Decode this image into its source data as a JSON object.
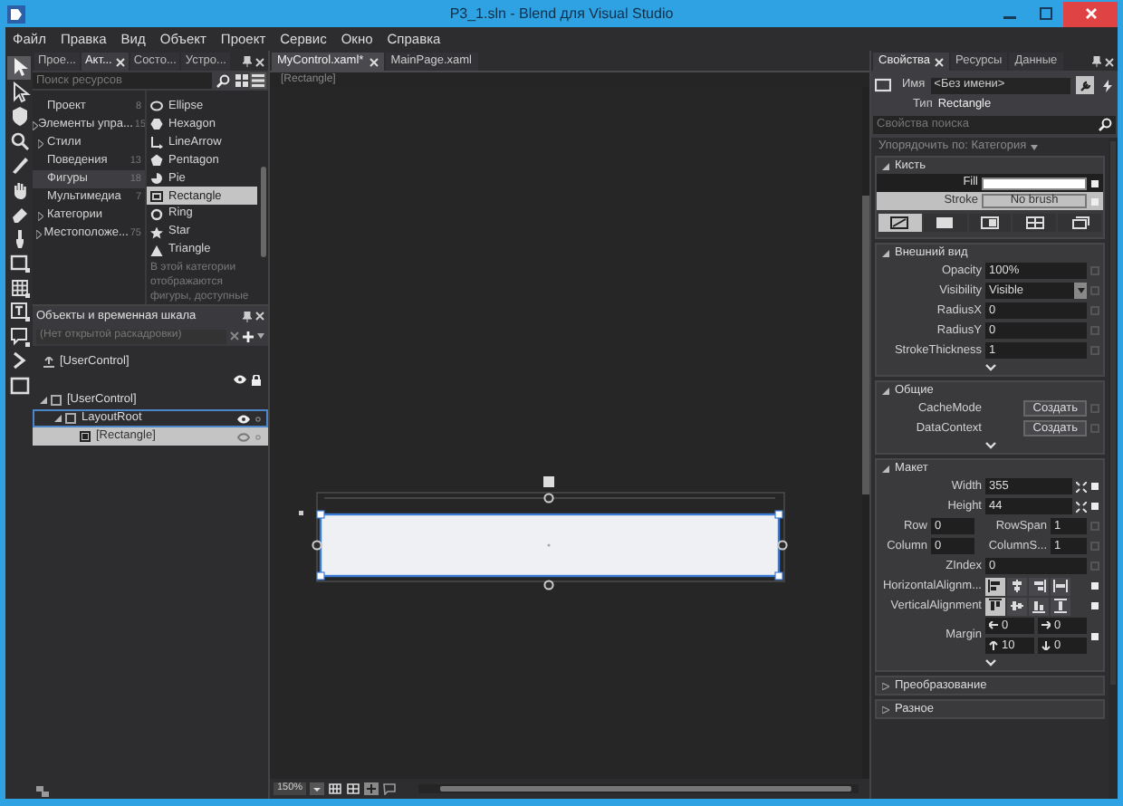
{
  "window": {
    "title": "P3_1.sln - Blend для Visual Studio"
  },
  "menu": [
    "Файл",
    "Правка",
    "Вид",
    "Объект",
    "Проект",
    "Сервис",
    "Окно",
    "Справка"
  ],
  "tools": [
    {
      "kind": "select",
      "selected": true
    },
    {
      "kind": "direct",
      "selected": false
    },
    {
      "kind": "pan",
      "selected": false
    },
    {
      "kind": "zoom",
      "selected": false
    },
    {
      "kind": "pen",
      "selected": false
    },
    {
      "kind": "hand",
      "selected": false
    },
    {
      "kind": "eraser",
      "selected": false
    },
    {
      "kind": "brush",
      "selected": false
    },
    {
      "kind": "rectangle",
      "selected": false
    },
    {
      "kind": "grid",
      "selected": false
    },
    {
      "kind": "text",
      "selected": false
    },
    {
      "kind": "control",
      "selected": false
    },
    {
      "kind": "more",
      "selected": false
    },
    {
      "kind": "border",
      "selected": false
    }
  ],
  "assets_panel": {
    "tabs": [
      {
        "label": "Прое...",
        "selected": false
      },
      {
        "label": "Акт...",
        "selected": true
      },
      {
        "label": "Состо...",
        "selected": false
      },
      {
        "label": "Устро...",
        "selected": false
      }
    ],
    "search": {
      "placeholder": "Поиск ресурсов"
    },
    "categories": [
      {
        "label": "Проект",
        "count": "8",
        "has_children": false,
        "selected": false
      },
      {
        "label": "Элементы упра...",
        "count": "15",
        "has_children": true,
        "selected": false
      },
      {
        "label": "Стили",
        "has_children": true,
        "selected": false
      },
      {
        "label": "Поведения",
        "count": "13",
        "has_children": false,
        "selected": false
      },
      {
        "label": "Фигуры",
        "count": "18",
        "has_children": false,
        "selected": true
      },
      {
        "label": "Мультимедиа",
        "count": "7",
        "has_children": false,
        "selected": false
      },
      {
        "label": "Категории",
        "has_children": true,
        "selected": false
      },
      {
        "label": "Местоположе...",
        "count": "75",
        "has_children": true,
        "selected": false
      }
    ],
    "assets": [
      {
        "label": "Ellipse",
        "kind": "ellipse",
        "selected": false
      },
      {
        "label": "Hexagon",
        "kind": "hexagon",
        "selected": false
      },
      {
        "label": "LineArrow",
        "kind": "arrow",
        "selected": false
      },
      {
        "label": "Pentagon",
        "kind": "pentagon",
        "selected": false
      },
      {
        "label": "Pie",
        "kind": "pie",
        "selected": false
      },
      {
        "label": "Rectangle",
        "kind": "rectangle",
        "selected": true
      },
      {
        "label": "Ring",
        "kind": "ring",
        "selected": false
      },
      {
        "label": "Star",
        "kind": "star",
        "selected": false
      },
      {
        "label": "Triangle",
        "kind": "triangle",
        "selected": false
      }
    ],
    "description": "В этой категории отображаются фигуры, доступные"
  },
  "objects_panel": {
    "title": "Объекты и временная шкала",
    "storyboard": {
      "placeholder": "(Нет открытой раскадровки)"
    },
    "scope": "[UserControl]",
    "tree": [
      {
        "label": "[UserControl]",
        "expanded": true,
        "active": false,
        "selected": false,
        "children": [
          {
            "label": "LayoutRoot",
            "expanded": true,
            "active": true,
            "selected": false,
            "children": [
              {
                "label": "[Rectangle]",
                "active": false,
                "selected": true
              }
            ]
          }
        ]
      }
    ]
  },
  "document": {
    "tabs": [
      {
        "label": "MyControl.xaml*",
        "selected": true
      },
      {
        "label": "MainPage.xaml",
        "selected": false
      }
    ],
    "breadcrumb": "[Rectangle]",
    "zoom": "150%"
  },
  "properties": {
    "tabs": [
      {
        "label": "Свойства",
        "selected": true
      },
      {
        "label": "Ресурсы",
        "selected": false
      },
      {
        "label": "Данные",
        "selected": false
      }
    ],
    "name": {
      "label": "Имя",
      "value": "<Без имени>"
    },
    "type": {
      "label": "Тип",
      "value": "Rectangle"
    },
    "search": {
      "placeholder": "Свойства поиска"
    },
    "arrange": "Упорядочить по: Категория",
    "sections": [
      {
        "title": "Кисть",
        "kind": "brush",
        "expanded": true,
        "brush_rows": [
          {
            "label": "Fill",
            "kind": "color",
            "color": "#ffffff",
            "selected": false
          },
          {
            "label": "Stroke",
            "kind": "none",
            "value": "No brush",
            "selected": true
          }
        ],
        "brush_tabs": [
          {
            "kind": "none",
            "selected": true
          },
          {
            "kind": "solid",
            "selected": false
          },
          {
            "kind": "gradient",
            "selected": false
          },
          {
            "kind": "tile",
            "selected": false
          },
          {
            "kind": "resource",
            "selected": false
          }
        ]
      },
      {
        "title": "Внешний вид",
        "kind": "rows",
        "expanded": true,
        "rows": [
          {
            "label": "Opacity",
            "kind": "text",
            "value": "100%",
            "local": false
          },
          {
            "label": "Visibility",
            "kind": "dropdown",
            "value": "Visible",
            "local": false
          },
          {
            "label": "RadiusX",
            "kind": "text",
            "value": "0",
            "local": false
          },
          {
            "label": "RadiusY",
            "kind": "text",
            "value": "0",
            "local": false
          },
          {
            "label": "StrokeThickness",
            "kind": "text",
            "value": "1",
            "local": false
          }
        ]
      },
      {
        "title": "Общие",
        "kind": "rows",
        "expanded": true,
        "rows": [
          {
            "label": "CacheMode",
            "kind": "button",
            "value": "Создать",
            "local": false
          },
          {
            "label": "DataContext",
            "kind": "button",
            "value": "Создать",
            "local": false
          }
        ]
      },
      {
        "title": "Макет",
        "kind": "rows",
        "expanded": true,
        "rows": [
          {
            "label": "Width",
            "kind": "size",
            "value": "355",
            "local": true
          },
          {
            "label": "Height",
            "kind": "size",
            "value": "44",
            "local": true
          },
          {
            "label": "Row",
            "kind": "pair",
            "value": "0",
            "label2": "RowSpan",
            "value2": "1",
            "local": false
          },
          {
            "label": "Column",
            "kind": "pair",
            "value": "0",
            "label2": "ColumnS...",
            "value2": "1",
            "local": false
          },
          {
            "label": "ZIndex",
            "kind": "text",
            "value": "0",
            "local": false
          },
          {
            "label": "HorizontalAlignm...",
            "kind": "align",
            "options": [
              {
                "kind": "left",
                "selected": true
              },
              {
                "kind": "center",
                "selected": false
              },
              {
                "kind": "right",
                "selected": false
              },
              {
                "kind": "stretch",
                "selected": false
              }
            ],
            "local": true
          },
          {
            "label": "VerticalAlignment",
            "kind": "align",
            "options": [
              {
                "kind": "top",
                "selected": true
              },
              {
                "kind": "middle",
                "selected": false
              },
              {
                "kind": "bottom",
                "selected": false
              },
              {
                "kind": "vstretch",
                "selected": false
              }
            ],
            "local": true
          },
          {
            "label": "Margin",
            "kind": "margin",
            "values": [
              "0",
              "0",
              "10",
              "0"
            ],
            "local": true
          }
        ]
      },
      {
        "title": "Преобразование",
        "expanded": false
      },
      {
        "title": "Разное",
        "expanded": false
      }
    ]
  }
}
